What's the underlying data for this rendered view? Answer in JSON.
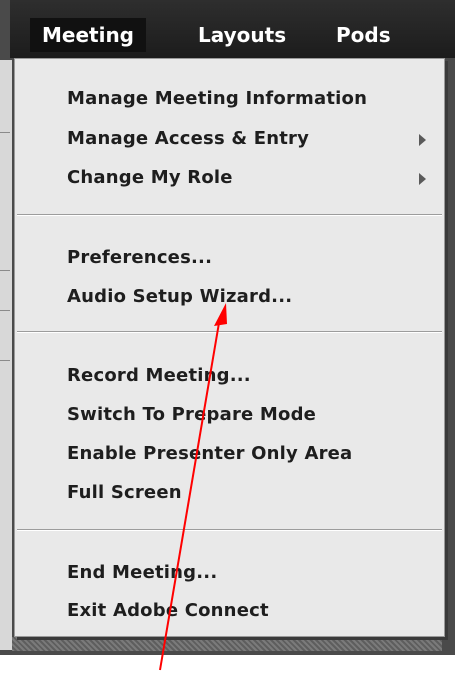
{
  "menubar": {
    "items": [
      {
        "label": "Meeting",
        "active": true
      },
      {
        "label": "Layouts",
        "active": false
      },
      {
        "label": "Pods",
        "active": false
      }
    ]
  },
  "dropdown": {
    "groups": [
      [
        {
          "label": "Manage Meeting Information",
          "submenu": false
        },
        {
          "label": "Manage Access & Entry",
          "submenu": true
        },
        {
          "label": "Change My Role",
          "submenu": true
        }
      ],
      [
        {
          "label": "Preferences...",
          "submenu": false
        },
        {
          "label": "Audio Setup Wizard...",
          "submenu": false
        }
      ],
      [
        {
          "label": "Record Meeting...",
          "submenu": false
        },
        {
          "label": "Switch To Prepare Mode",
          "submenu": false
        },
        {
          "label": "Enable Presenter Only Area",
          "submenu": false
        },
        {
          "label": "Full Screen",
          "submenu": false
        }
      ],
      [
        {
          "label": "End Meeting...",
          "submenu": false
        },
        {
          "label": "Exit Adobe Connect",
          "submenu": false
        }
      ]
    ]
  },
  "annotation": {
    "color": "#ff0000",
    "type": "arrow",
    "points_to": "Audio Setup Wizard..."
  },
  "colors": {
    "menubar": "#222222",
    "menu_bg": "#e9e9e9",
    "text": "#1e1e1e"
  }
}
